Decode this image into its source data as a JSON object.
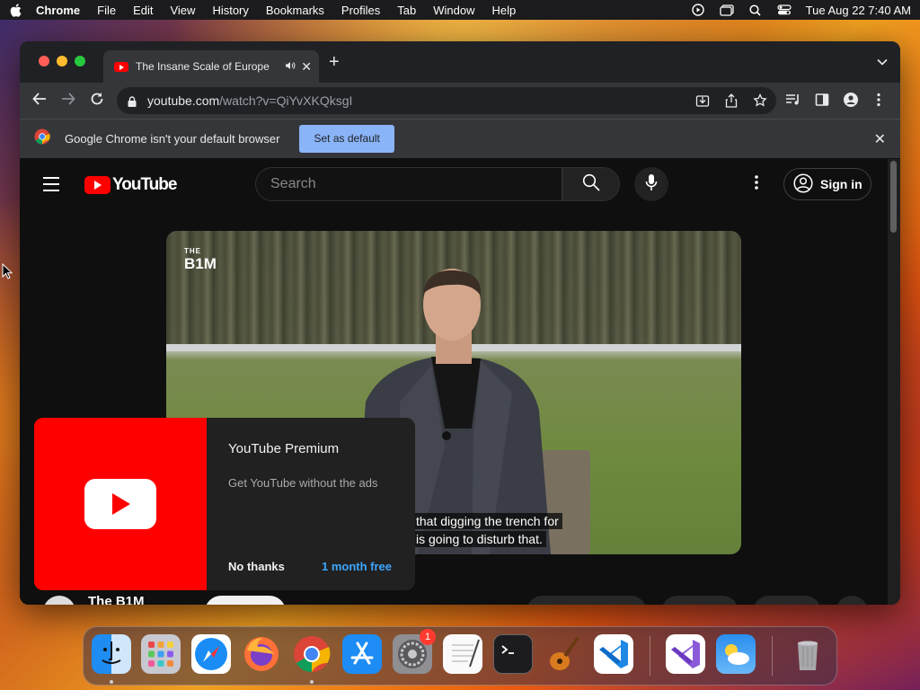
{
  "menubar": {
    "app_name": "Chrome",
    "items": [
      "File",
      "Edit",
      "View",
      "History",
      "Bookmarks",
      "Profiles",
      "Tab",
      "Window",
      "Help"
    ],
    "clock": "Tue Aug 22  7:40 AM"
  },
  "browser": {
    "tab_title": "The Insane Scale of Europe",
    "url_host": "youtube.com",
    "url_path": "/watch?v=QiYvXKQksgI",
    "infobar": {
      "message": "Google Chrome isn't your default browser",
      "button_label": "Set as default"
    }
  },
  "youtube": {
    "logo_text": "YouTube",
    "search_placeholder": "Search",
    "signin_label": "Sign in",
    "video": {
      "watermark_small": "THE",
      "watermark_big": "B1M",
      "caption_line1": "that digging the trench for",
      "caption_line2": "is going to disturb that."
    },
    "premium_popup": {
      "title": "YouTube Premium",
      "subtitle": "Get YouTube without the ads",
      "decline_label": "No thanks",
      "accept_label": "1 month free"
    },
    "channel_name": "The B1M"
  },
  "dock": {
    "items": [
      "Finder",
      "Launchpad",
      "Safari",
      "Firefox",
      "Google Chrome",
      "App Store",
      "System Settings",
      "TextEdit",
      "Terminal",
      "GarageBand",
      "Visual Studio Code",
      "Visual Studio",
      "Weather",
      "Trash"
    ],
    "system_settings_badge": "1"
  },
  "colors": {
    "youtube_red": "#ff0000",
    "link_blue": "#3ea6ff",
    "chrome_button_blue": "#8ab4f8"
  }
}
